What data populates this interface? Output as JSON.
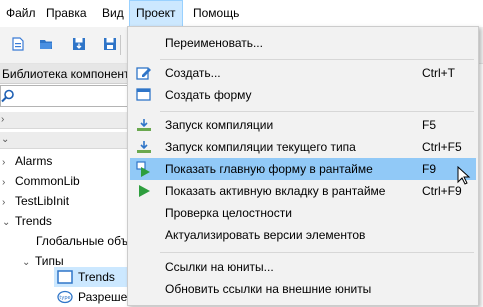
{
  "menubar": {
    "items": [
      {
        "label": "Файл"
      },
      {
        "label": "Правка"
      },
      {
        "label": "Вид"
      },
      {
        "label": "Проект"
      },
      {
        "label": "Помощь"
      }
    ]
  },
  "library": {
    "title": "Библиотека компонентов",
    "tree": [
      {
        "label": "Alarms",
        "expanded": false
      },
      {
        "label": "CommonLib",
        "expanded": false
      },
      {
        "label": "TestLibInit",
        "expanded": false
      },
      {
        "label": "Trends",
        "expanded": true
      },
      {
        "label": "Глобальные объ"
      },
      {
        "label": "Типы",
        "expanded": true
      },
      {
        "label": "Trends",
        "selected": true
      },
      {
        "label": "Разрешения"
      }
    ]
  },
  "project_menu": {
    "items": [
      {
        "label": "Переименовать...",
        "shortcut": ""
      },
      {
        "label": "Создать...",
        "shortcut": "Ctrl+T"
      },
      {
        "label": "Создать форму",
        "shortcut": ""
      },
      {
        "label": "Запуск компиляции",
        "shortcut": "F5"
      },
      {
        "label": "Запуск компиляции текущего типа",
        "shortcut": "Ctrl+F5"
      },
      {
        "label": "Показать главную форму в рантайме",
        "shortcut": "F9",
        "highlighted": true
      },
      {
        "label": "Показать активную вкладку в рантайме",
        "shortcut": "Ctrl+F9"
      },
      {
        "label": "Проверка целостности",
        "shortcut": ""
      },
      {
        "label": "Актуализировать версии элементов",
        "shortcut": ""
      },
      {
        "label": "Ссылки на юниты...",
        "shortcut": ""
      },
      {
        "label": "Обновить ссылки на внешние юниты",
        "shortcut": ""
      }
    ]
  },
  "colors": {
    "highlight": "#91c9f7",
    "menu_active": "#cce8ff",
    "menu_bg": "#f2f2f2"
  }
}
